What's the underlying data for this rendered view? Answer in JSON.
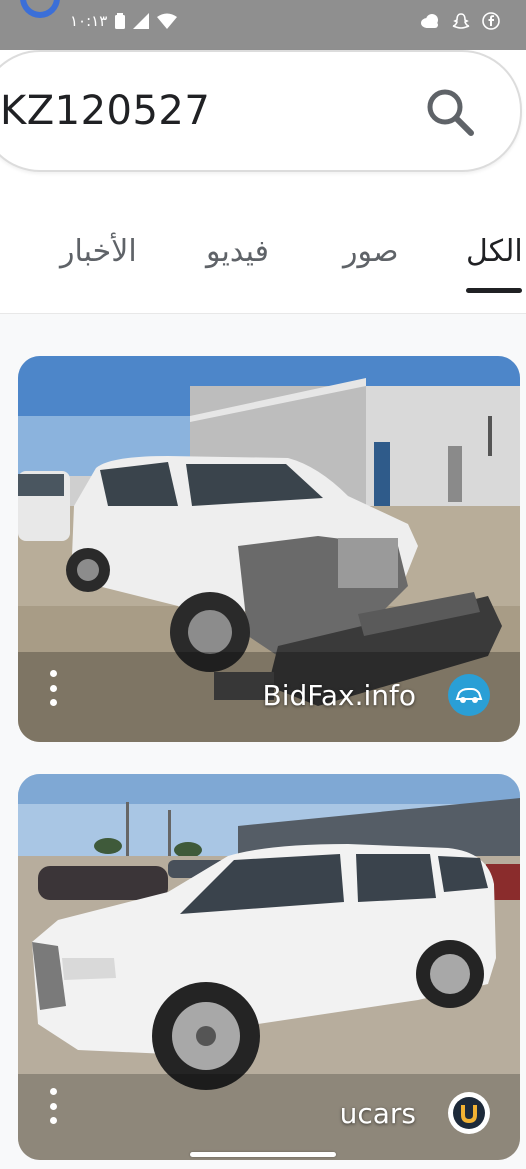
{
  "status_bar": {
    "time": "١٠:١٣",
    "left_icons": [
      "battery-icon",
      "signal-icon",
      "wifi-icon"
    ],
    "right_icons": [
      "cloud-icon",
      "snapchat-icon",
      "facebook-icon"
    ]
  },
  "search": {
    "query": "KZ120527"
  },
  "tabs": [
    {
      "label": "الكل",
      "active": true
    },
    {
      "label": "صور",
      "active": false
    },
    {
      "label": "فيديو",
      "active": false
    },
    {
      "label": "الأخبار",
      "active": false
    }
  ],
  "results": [
    {
      "source": "BidFax.info",
      "badge_icon": "car-icon"
    },
    {
      "source": "ucars",
      "badge_icon": "u-logo-icon"
    }
  ],
  "colors": {
    "status_bar_bg": "#8f8f8f",
    "accent_underline": "#202124",
    "muted_text": "#5f6368"
  }
}
